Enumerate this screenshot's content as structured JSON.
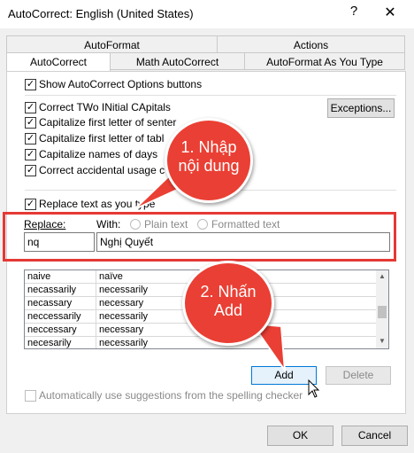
{
  "window": {
    "title": "AutoCorrect: English (United States)",
    "help": "?",
    "close": "✕"
  },
  "tabs": {
    "row1": [
      "AutoFormat",
      "Actions"
    ],
    "row2": [
      "AutoCorrect",
      "Math AutoCorrect",
      "AutoFormat As You Type"
    ]
  },
  "options": {
    "show_buttons": "Show AutoCorrect Options buttons",
    "two_initial": "Correct TWo INitial CApitals",
    "first_sentence": "Capitalize first letter of senter",
    "first_table": "Capitalize first letter of tabl",
    "names_days": "Capitalize names of days",
    "caps_lock": "Correct accidental usage c",
    "exceptions_label": "Exceptions..."
  },
  "replace_section": {
    "replace_as_type": "Replace text as you type",
    "replace_label": "Replace:",
    "with_label": "With:",
    "plain_text": "Plain text",
    "formatted_text": "Formatted text",
    "replace_value": "nq",
    "with_value": "Nghị Quyết"
  },
  "table": {
    "rows": [
      [
        "naive",
        "naïve"
      ],
      [
        "necassarily",
        "necessarily"
      ],
      [
        "necassary",
        "necessary"
      ],
      [
        "neccessarily",
        "necessarily"
      ],
      [
        "neccessary",
        "necessary"
      ],
      [
        "necesarily",
        "necessarily"
      ]
    ]
  },
  "buttons": {
    "add": "Add",
    "delete": "Delete",
    "ok": "OK",
    "cancel": "Cancel"
  },
  "spelling": "Automatically use suggestions from the spelling checker",
  "callouts": {
    "one_line1": "1. Nhập",
    "one_line2": "nội dung",
    "two_line1": "2. Nhấn",
    "two_line2": "Add"
  },
  "colors": {
    "accent_red": "#ea3f34",
    "highlight_blue": "#0078d7"
  }
}
